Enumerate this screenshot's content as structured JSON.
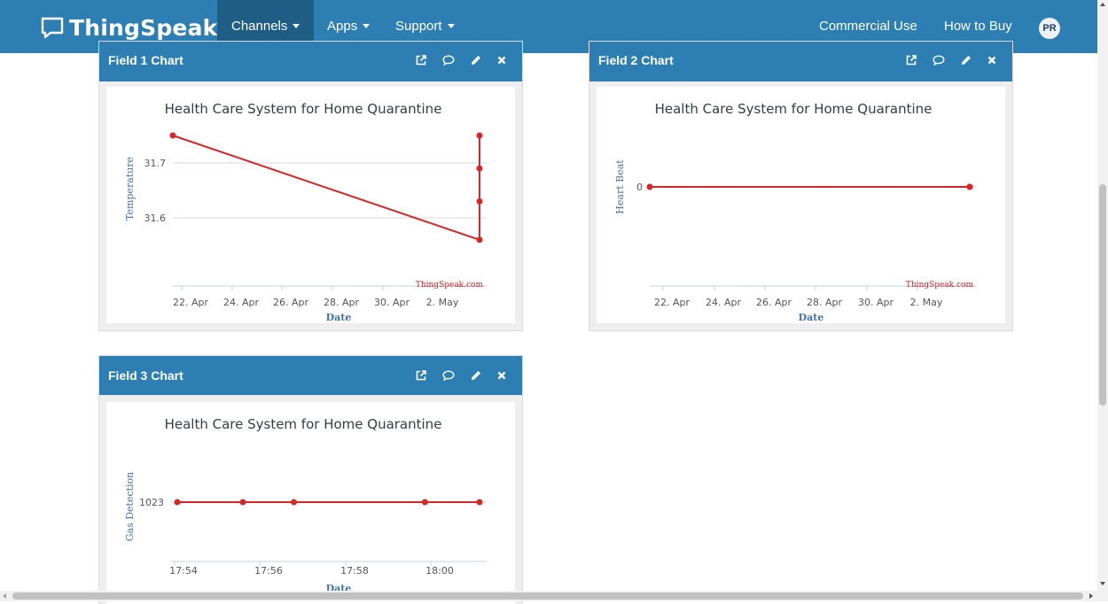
{
  "nav": {
    "brand": "ThingSpeak",
    "trademark": "™",
    "channels": "Channels",
    "apps": "Apps",
    "support": "Support",
    "commercial": "Commercial Use",
    "how_to_buy": "How to Buy",
    "avatar": "PR"
  },
  "panels": [
    {
      "title": "Field 1 Chart"
    },
    {
      "title": "Field 2 Chart"
    },
    {
      "title": "Field 3 Chart"
    }
  ],
  "colors": {
    "nav": "#2d7fb3",
    "nav_active": "#1f5d84",
    "series": "#d62728",
    "axis_title": "#4572a7"
  },
  "chart_data": [
    {
      "type": "line",
      "title": "Health Care System for Home Quarantine",
      "xlabel": "Date",
      "ylabel": "Temperature",
      "x_ticks": [
        "22. Apr",
        "24. Apr",
        "26. Apr",
        "28. Apr",
        "30. Apr",
        "2. May"
      ],
      "y_ticks": [
        31.6,
        31.7
      ],
      "ylim": [
        31.55,
        31.76
      ],
      "credit": "ThingSpeak.com",
      "points": [
        [
          "2020-04-21",
          31.75
        ],
        [
          "2020-05-04",
          31.56
        ],
        [
          "2020-05-04",
          31.63
        ],
        [
          "2020-05-04",
          31.69
        ],
        [
          "2020-05-04",
          31.75
        ]
      ]
    },
    {
      "type": "line",
      "title": "Health Care System for Home Quarantine",
      "xlabel": "Date",
      "ylabel": "Heart Beat",
      "x_ticks": [
        "22. Apr",
        "24. Apr",
        "26. Apr",
        "28. Apr",
        "30. Apr",
        "2. May"
      ],
      "y_ticks": [
        0
      ],
      "credit": "ThingSpeak.com",
      "points": [
        [
          "2020-04-21",
          0
        ],
        [
          "2020-05-04",
          0
        ],
        [
          "2020-05-04",
          0
        ]
      ]
    },
    {
      "type": "line",
      "title": "Health Care System for Home Quarantine",
      "xlabel": "Date",
      "ylabel": "Gas Detection",
      "x_ticks": [
        "17:54",
        "17:56",
        "17:58",
        "18:00"
      ],
      "y_ticks": [
        1023
      ],
      "points": [
        [
          "17:54",
          1023
        ],
        [
          "17:55:30",
          1023
        ],
        [
          "17:56:40",
          1023
        ],
        [
          "17:59:40",
          1023
        ],
        [
          "18:00:55",
          1023
        ]
      ]
    }
  ]
}
